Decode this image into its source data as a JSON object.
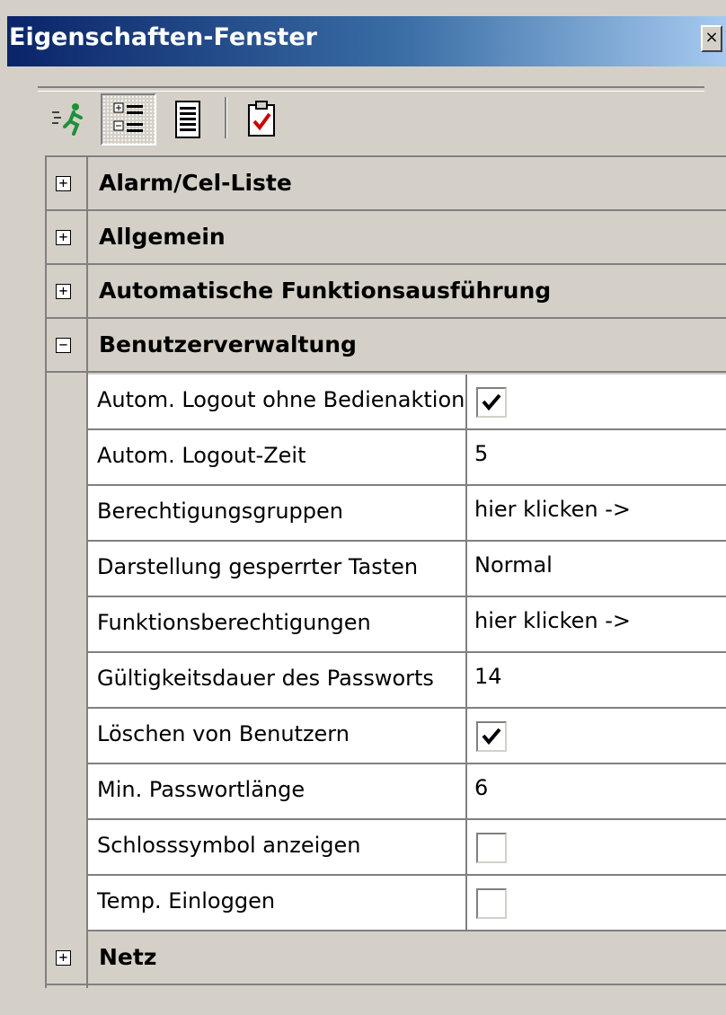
{
  "window": {
    "title": "Eigenschaften-Fenster",
    "close_glyph": "×"
  },
  "toolbar": {
    "buttons": [
      {
        "name": "run-icon"
      },
      {
        "name": "categorized-view-icon"
      },
      {
        "name": "alphabetical-view-icon"
      },
      {
        "name": "property-pages-icon"
      }
    ]
  },
  "categories": [
    {
      "label": "Alarm/Cel-Liste",
      "expanded": false,
      "expander": "+"
    },
    {
      "label": "Allgemein",
      "expanded": false,
      "expander": "+"
    },
    {
      "label": "Automatische Funktionsausführung",
      "expanded": false,
      "expander": "+"
    },
    {
      "label": "Benutzerverwaltung",
      "expanded": true,
      "expander": "−"
    },
    {
      "label": "Netz",
      "expanded": false,
      "expander": "+"
    }
  ],
  "properties": [
    {
      "name": "Autom. Logout ohne Bedienaktion",
      "type": "checkbox",
      "checked": true
    },
    {
      "name": "Autom. Logout-Zeit",
      "type": "text",
      "value": "5"
    },
    {
      "name": "Berechtigungsgruppen",
      "type": "text",
      "value": "hier klicken ->"
    },
    {
      "name": "Darstellung gesperrter Tasten",
      "type": "text",
      "value": "Normal"
    },
    {
      "name": "Funktionsberechtigungen",
      "type": "text",
      "value": "hier klicken ->"
    },
    {
      "name": "Gültigkeitsdauer des Passworts",
      "type": "text",
      "value": "14"
    },
    {
      "name": "Löschen von Benutzern",
      "type": "checkbox",
      "checked": true
    },
    {
      "name": "Min. Passwortlänge",
      "type": "text",
      "value": "6"
    },
    {
      "name": "Schlosssymbol anzeigen",
      "type": "checkbox",
      "checked": false
    },
    {
      "name": "Temp. Einloggen",
      "type": "checkbox",
      "checked": false
    }
  ],
  "colors": {
    "title_start": "#0a246a",
    "title_end": "#a6caf0",
    "panel": "#d4d0c8",
    "grid_line": "#808080",
    "check_mark": "#000000",
    "clipboard_check": "#cc0000"
  }
}
